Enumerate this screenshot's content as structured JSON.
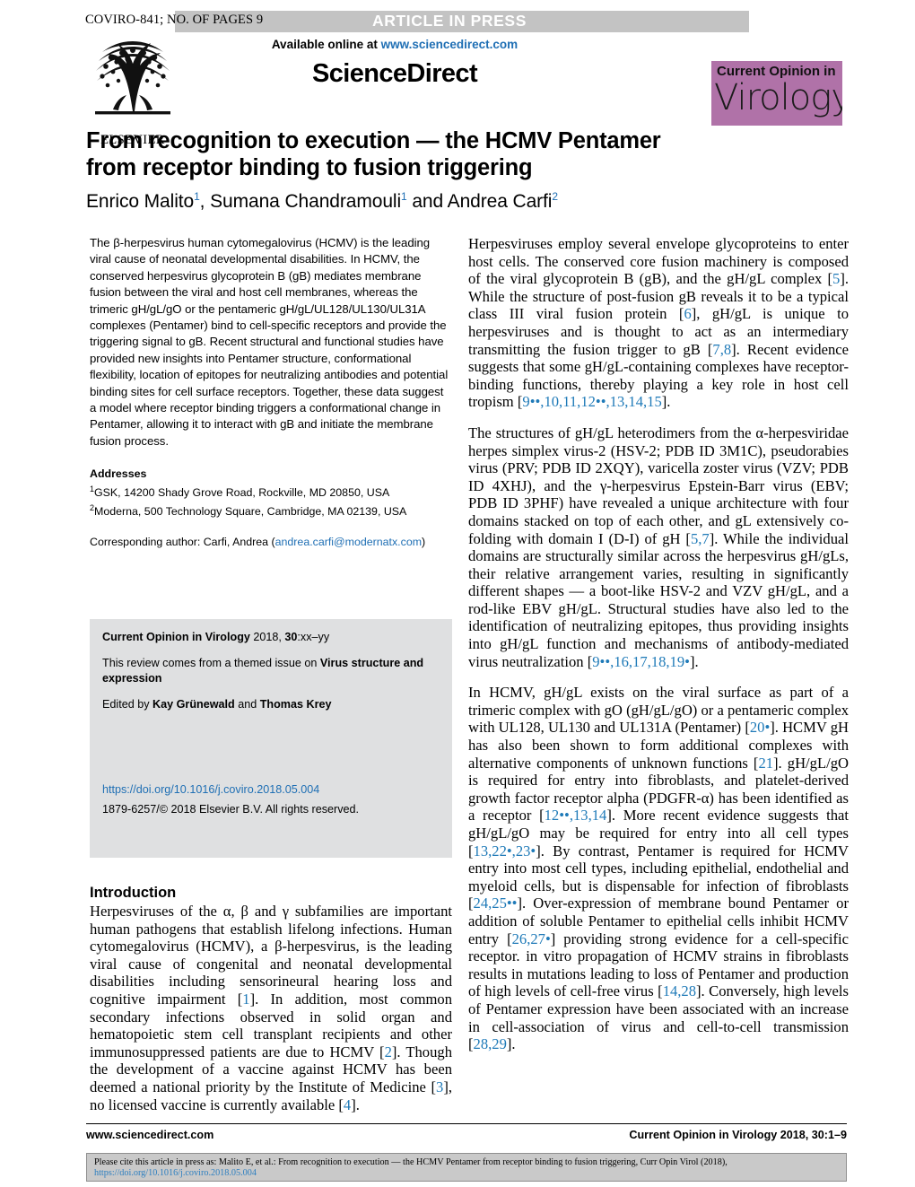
{
  "running_head": {
    "code": "COVIRO-841; NO. OF PAGES 9",
    "press_banner": "ARTICLE IN PRESS"
  },
  "masthead": {
    "publisher_logo_name": "elsevier-tree-logo",
    "publisher_wordmark": "ELSEVIER",
    "available_prefix": "Available online at ",
    "available_url": "www.sciencedirect.com",
    "sciencedirect_wordmark": "ScienceDirect",
    "journal_badge": {
      "line1": "Current Opinion in",
      "line2": "Virology",
      "background_color": "#b072a8"
    }
  },
  "article": {
    "title_line1": "From recognition to execution — the HCMV Pentamer",
    "title_line2": "from receptor binding to fusion triggering",
    "authors_plain": "Enrico Malito1, Sumana Chandramouli1 and Andrea Carfi2",
    "authors": [
      {
        "name": "Enrico Malito",
        "affil": "1"
      },
      {
        "name": "Sumana Chandramouli",
        "affil": "1"
      },
      {
        "name": "Andrea Carfi",
        "affil": "2"
      }
    ]
  },
  "abstract": "The β-herpesvirus human cytomegalovirus (HCMV) is the leading viral cause of neonatal developmental disabilities. In HCMV, the conserved herpesvirus glycoprotein B (gB) mediates membrane fusion between the viral and host cell membranes, whereas the trimeric gH/gL/gO or the pentameric gH/gL/UL128/UL130/UL31A complexes (Pentamer) bind to cell-specific receptors and provide the triggering signal to gB. Recent structural and functional studies have provided new insights into Pentamer structure, conformational flexibility, location of epitopes for neutralizing antibodies and potential binding sites for cell surface receptors. Together, these data suggest a model where receptor binding triggers a conformational change in Pentamer, allowing it to interact with gB and initiate the membrane fusion process.",
  "addresses": {
    "heading": "Addresses",
    "items": [
      {
        "marker": "1",
        "text": "GSK, 14200 Shady Grove Road, Rockville, MD 20850, USA"
      },
      {
        "marker": "2",
        "text": "Moderna, 500 Technology Square, Cambridge, MA 02139, USA"
      }
    ],
    "corresponding_prefix": "Corresponding author: Carfi, Andrea (",
    "corresponding_email": "andrea.carfi@modernatx.com",
    "corresponding_suffix": ")"
  },
  "journal_box": {
    "citation_bold": "Current Opinion in Virology",
    "citation_rest": " 2018, ",
    "citation_volume": "30",
    "citation_pages": ":xx–yy",
    "themed_prefix": "This review comes from a themed issue on ",
    "themed_issue": "Virus structure and expression",
    "edited_prefix": "Edited by ",
    "editor1": "Kay Grünewald",
    "edited_join": " and ",
    "editor2": "Thomas Krey",
    "doi": "https://doi.org/10.1016/j.coviro.2018.05.004",
    "copyright": "1879-6257/© 2018 Elsevier B.V. All rights reserved."
  },
  "introduction": {
    "heading": "Introduction",
    "paragraph": "Herpesviruses of the α, β and γ subfamilies are important human pathogens that establish lifelong infections. Human cytomegalovirus (HCMV), a β-herpesvirus, is the leading viral cause of congenital and neonatal developmental disabilities including sensorineural hearing loss and cognitive impairment [1]. In addition, most common secondary infections observed in solid organ and hematopoietic stem cell transplant recipients and other immunosuppressed patients are due to HCMV [2]. Though the development of a vaccine against HCMV has been deemed a national priority by the Institute of Medicine [3], no licensed vaccine is currently available [4]."
  },
  "right_column": {
    "paragraph1": "Herpesviruses employ several envelope glycoproteins to enter host cells. The conserved core fusion machinery is composed of the viral glycoprotein B (gB), and the gH/gL complex [5]. While the structure of post-fusion gB reveals it to be a typical class III viral fusion protein [6], gH/gL is unique to herpesviruses and is thought to act as an intermediary transmitting the fusion trigger to gB [7,8]. Recent evidence suggests that some gH/gL-containing complexes have receptor-binding functions, thereby playing a key role in host cell tropism [9••,10,11,12••,13,14,15].",
    "paragraph2": "The structures of gH/gL heterodimers from the α-herpesviridae herpes simplex virus-2 (HSV-2; PDB ID 3M1C), pseudorabies virus (PRV; PDB ID 2XQY), varicella zoster virus (VZV; PDB ID 4XHJ), and the γ-herpesvirus Epstein-Barr virus (EBV; PDB ID 3PHF) have revealed a unique architecture with four domains stacked on top of each other, and gL extensively co-folding with domain I (D-I) of gH [5,7]. While the individual domains are structurally similar across the herpesvirus gH/gLs, their relative arrangement varies, resulting in significantly different shapes — a boot-like HSV-2 and VZV gH/gL, and a rod-like EBV gH/gL. Structural studies have also led to the identification of neutralizing epitopes, thus providing insights into gH/gL function and mechanisms of antibody-mediated virus neutralization [9••,16,17,18,19•].",
    "paragraph3": "In HCMV, gH/gL exists on the viral surface as part of a trimeric complex with gO (gH/gL/gO) or a pentameric complex with UL128, UL130 and UL131A (Pentamer) [20•]. HCMV gH has also been shown to form additional complexes with alternative components of unknown functions [21]. gH/gL/gO is required for entry into fibroblasts, and platelet-derived growth factor receptor alpha (PDGFR-α) has been identified as a receptor [12••,13,14]. More recent evidence suggests that gH/gL/gO may be required for entry into all cell types [13,22•,23•]. By contrast, Pentamer is required for HCMV entry into most cell types, including epithelial, endothelial and myeloid cells, but is dispensable for infection of fibroblasts [24,25••]. Over-expression of membrane bound Pentamer or addition of soluble Pentamer to epithelial cells inhibit HCMV entry [26,27•] providing strong evidence for a cell-specific receptor. in vitro propagation of HCMV strains in fibroblasts results in mutations leading to loss of Pentamer and production of high levels of cell-free virus [14,28]. Conversely, high levels of Pentamer expression have been associated with an increase in cell-association of virus and cell-to-cell transmission [28,29]."
  },
  "footer": {
    "left": "www.sciencedirect.com",
    "right": "Current Opinion in Virology 2018, 30:1–9",
    "cite_prefix": "Please cite this article in press as: Malito E, et al.: From recognition to execution — the HCMV Pentamer from receptor binding to fusion triggering, Curr Opin Virol (2018), ",
    "cite_link": "https://doi.org/10.1016/j.coviro.2018.05.004"
  },
  "colors": {
    "link": "#1f6fb4",
    "reference": "#1f7ab8",
    "badge": "#b072a8",
    "gray_box": "#dfe0e1",
    "banner_gray": "#c3c3c3"
  }
}
